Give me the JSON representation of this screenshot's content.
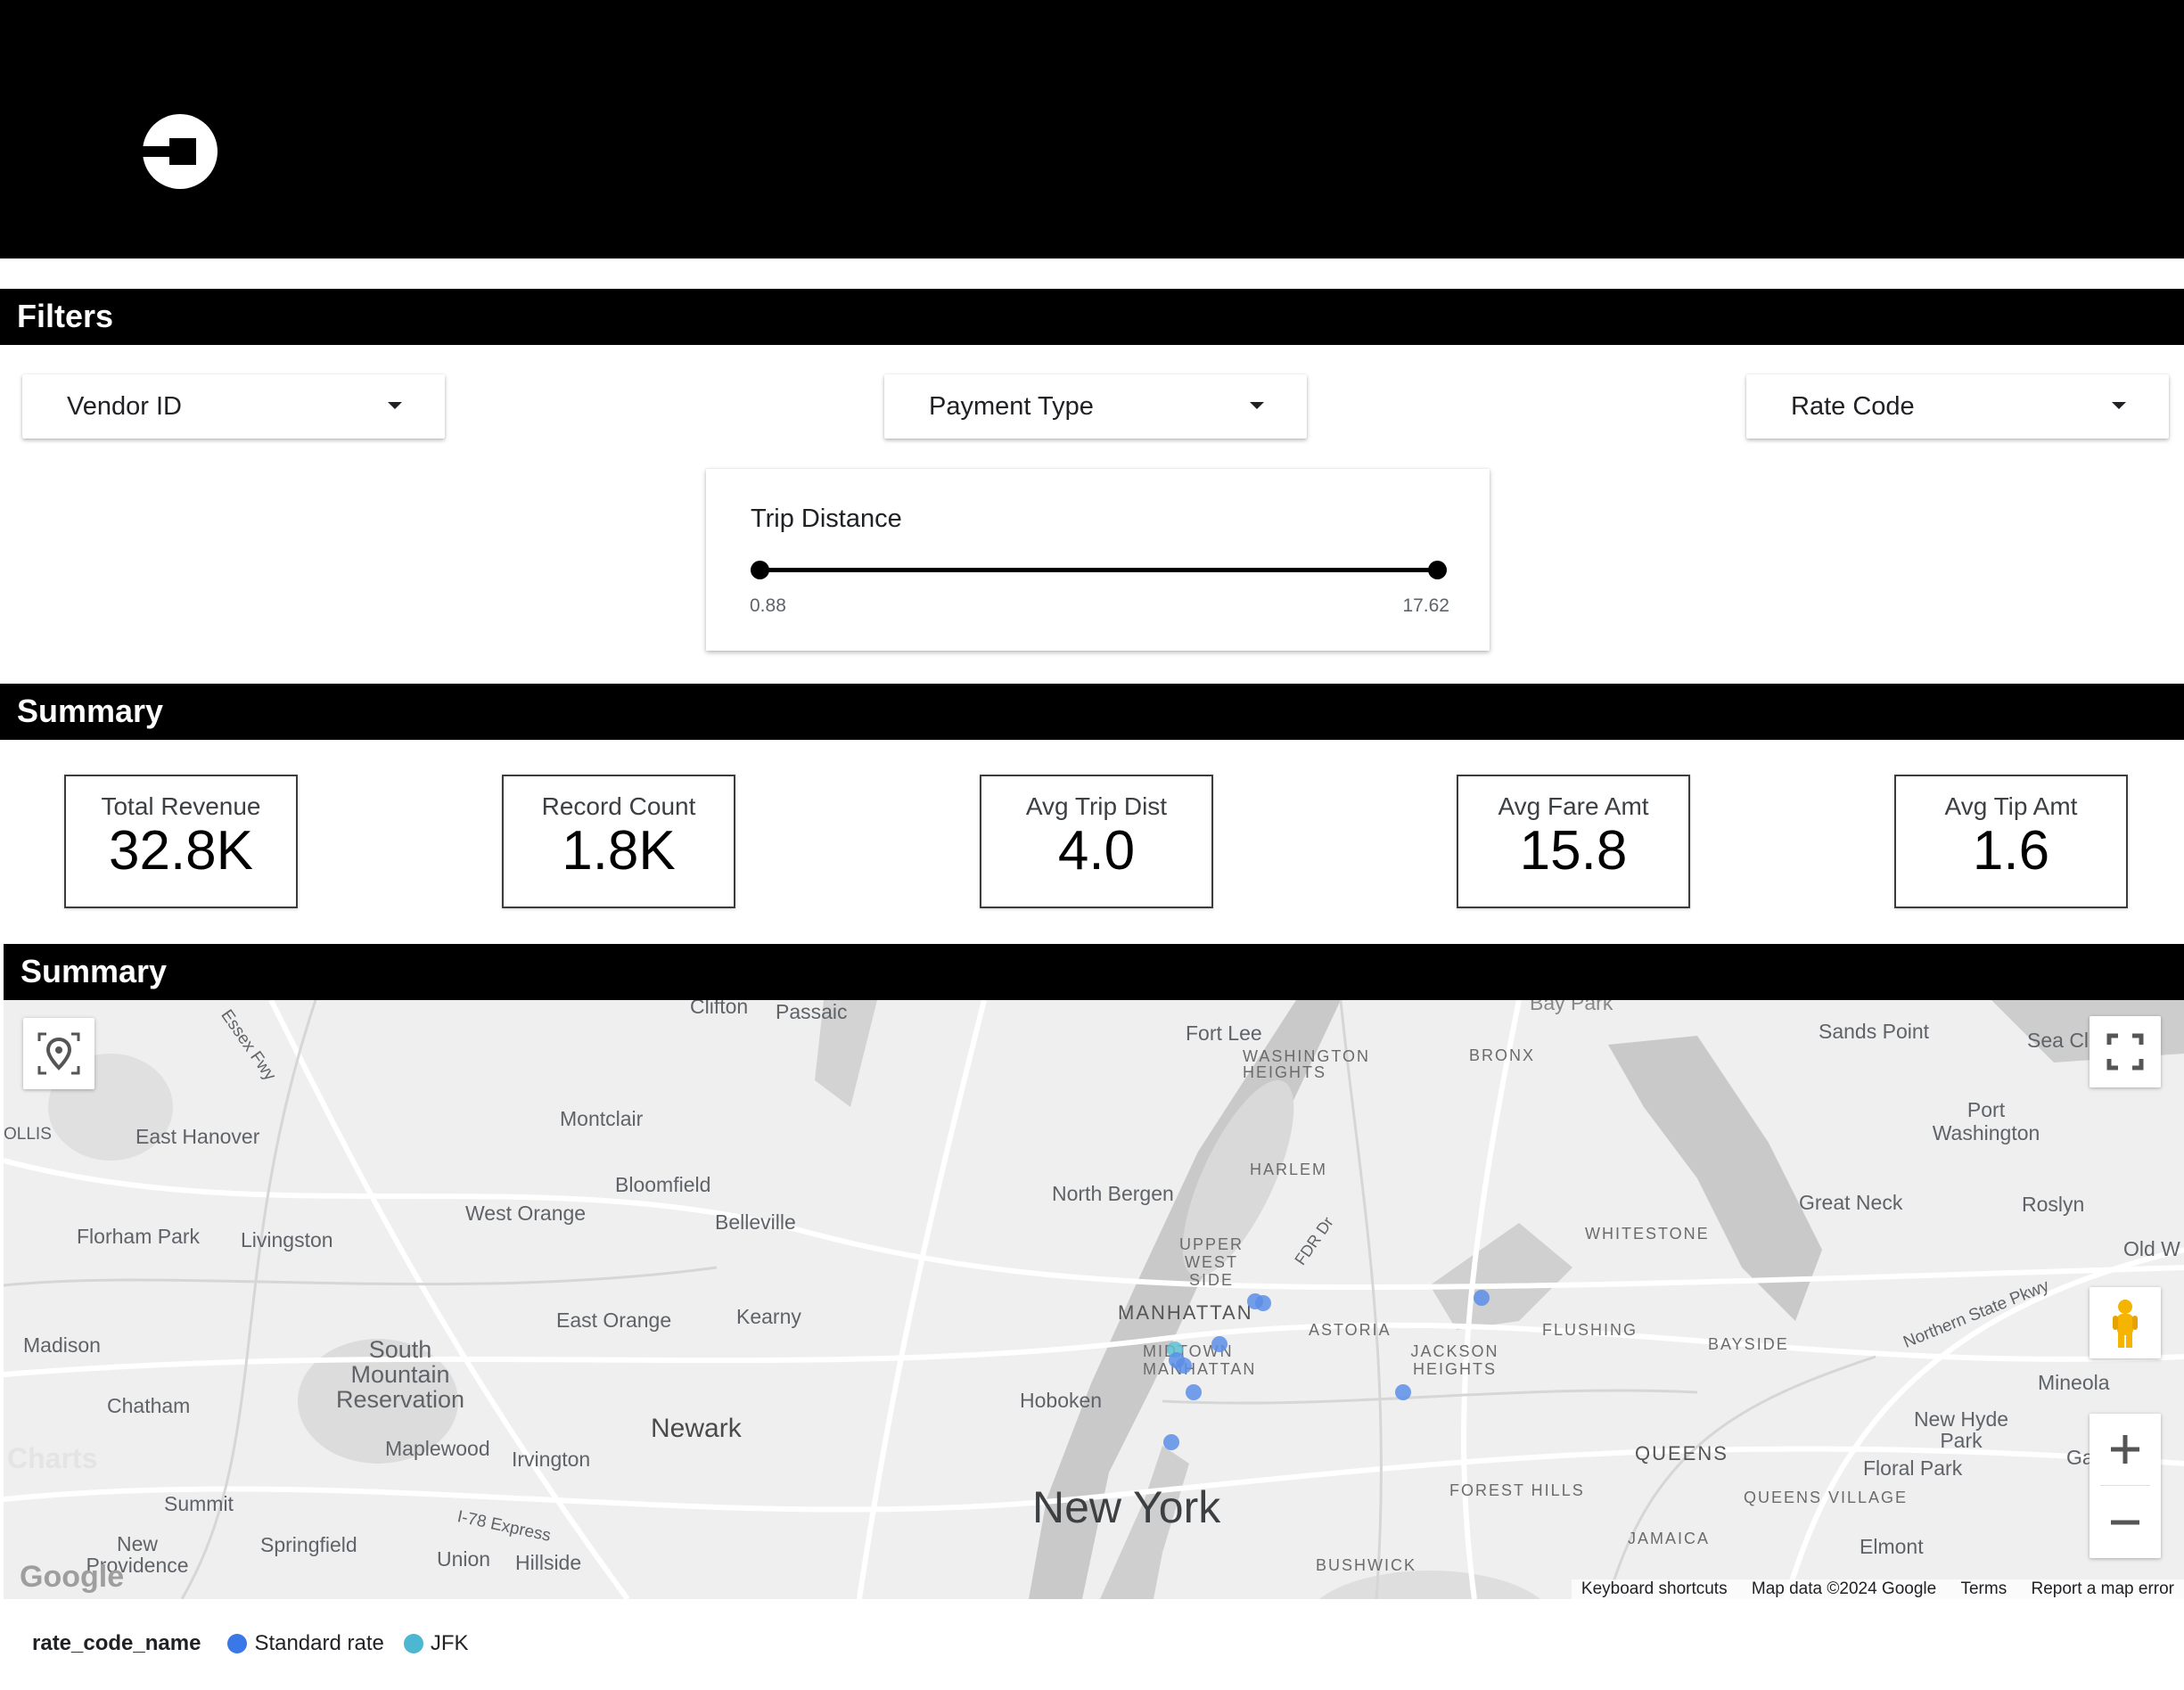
{
  "header": {
    "logo_icon": "uber-logo-icon"
  },
  "sections": {
    "filters": "Filters",
    "summary": "Summary",
    "map_summary": "Summary"
  },
  "filters": {
    "vendor": "Vendor ID",
    "payment": "Payment Type",
    "rate": "Rate Code",
    "trip_distance": {
      "title": "Trip Distance",
      "min": "0.88",
      "max": "17.62"
    }
  },
  "kpis": [
    {
      "label": "Total Revenue",
      "value": "32.8K"
    },
    {
      "label": "Record Count",
      "value": "1.8K"
    },
    {
      "label": "Avg Trip Dist",
      "value": "4.0"
    },
    {
      "label": "Avg Fare Amt",
      "value": "15.8"
    },
    {
      "label": "Avg Tip Amt",
      "value": "1.6"
    }
  ],
  "map": {
    "labels": {
      "clifton": "Clifton",
      "passaic": "Passaic",
      "fort_lee": "Fort Lee",
      "washington_heights": "WASHINGTON HEIGHTS",
      "bronx": "BRONX",
      "sands_point": "Sands Point",
      "sea_cliff": "Sea Cl",
      "essex_fwy": "Essex Fwy",
      "east_hanover": "East Hanover",
      "montclair": "Montclair",
      "port_washington": "Port Washington",
      "harlem": "HARLEM",
      "bloomfield": "Bloomfield",
      "north_bergen": "North Bergen",
      "great_neck": "Great Neck",
      "roslyn": "Roslyn",
      "west_orange": "West Orange",
      "belleville": "Belleville",
      "whitestone": "WHITESTONE",
      "florham_park": "Florham Park",
      "livingston": "Livingston",
      "upper_west_side": "UPPER WEST SIDE",
      "fdr": "FDR Dr",
      "old_w": "Old W",
      "manhattan": "MANHATTAN",
      "east_orange": "East Orange",
      "kearny": "Kearny",
      "astoria": "ASTORIA",
      "flushing": "FLUSHING",
      "bayside": "BAYSIDE",
      "northern_state": "Northern State Pkwy",
      "madison": "Madison",
      "south_mountain": "South Mountain Reservation",
      "midtown": "MIDTOWN MANHATTAN",
      "jackson_heights": "JACKSON HEIGHTS",
      "mineola": "Mineola",
      "chatham": "Chatham",
      "hoboken": "Hoboken",
      "newark": "Newark",
      "new_hyde_park": "New Hyde Park",
      "maplewood": "Maplewood",
      "irvington": "Irvington",
      "queens": "QUEENS",
      "floral_park": "Floral Park",
      "garden": "Gard",
      "summit": "Summit",
      "new_york": "New York",
      "forest_hills": "FOREST HILLS",
      "queens_village": "QUEENS VILLAGE",
      "i78": "I-78 Express",
      "new_providence": "New Providence",
      "springfield": "Springfield",
      "union": "Union",
      "hillside": "Hillside",
      "jamaica": "JAMAICA",
      "elmont": "Elmont",
      "bushwick": "BUSHWICK",
      "ollis": "OLLIS",
      "charts": "Charts",
      "bay_park": "Bay Park"
    },
    "attribution": {
      "shortcuts": "Keyboard shortcuts",
      "data": "Map data ©2024 Google",
      "terms": "Terms",
      "report": "Report a map error"
    },
    "google_logo": "Google",
    "controls": {
      "locate_icon": "location-pin-icon",
      "fullscreen_icon": "fullscreen-icon",
      "pegman_icon": "pegman-icon",
      "zoom_in_icon": "plus-icon",
      "zoom_out_icon": "minus-icon"
    }
  },
  "legend": {
    "title": "rate_code_name",
    "items": [
      {
        "label": "Standard rate",
        "color": "#3b78e7"
      },
      {
        "label": "JFK",
        "color": "#4db6d0"
      }
    ]
  }
}
